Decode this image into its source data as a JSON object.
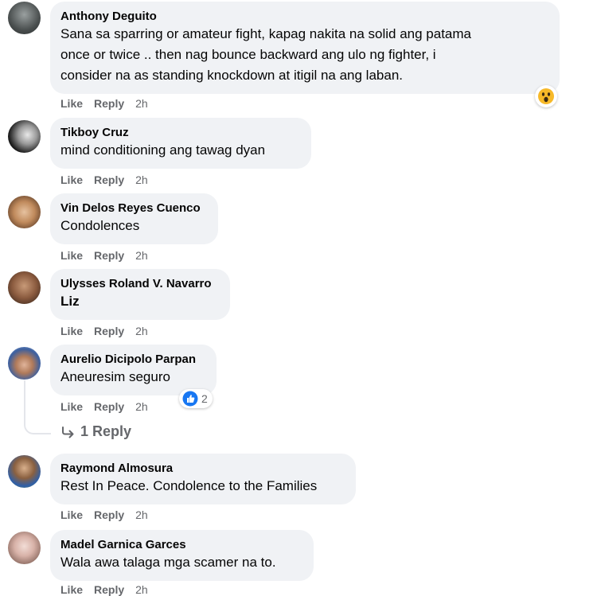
{
  "colors": {
    "bubble_bg": "#f0f2f5",
    "action_text": "#65676b",
    "like_blue": "#1877f2",
    "wow_yellow": "#f7b928"
  },
  "actions": {
    "like": "Like",
    "reply": "Reply"
  },
  "comments": [
    {
      "author": "Anthony Deguito",
      "lines": [
        "Sana sa sparring or amateur fight, kapag nakita na solid ang patama",
        "once or twice .. then nag bounce backward ang ulo ng fighter, i",
        "consider na as standing knockdown at itigil na ang laban."
      ],
      "time": "2h",
      "reaction_icon": "wow-reaction-icon"
    },
    {
      "author": "Tikboy Cruz",
      "lines": [
        "mind conditioning ang tawag dyan"
      ],
      "time": "2h"
    },
    {
      "author": "Vin Delos Reyes Cuenco",
      "lines": [
        "Condolences"
      ],
      "time": "2h"
    },
    {
      "author": "Ulysses Roland V. Navarro",
      "lines": [
        "Liz"
      ],
      "time": "2h"
    },
    {
      "author": "Aurelio Dicipolo Parpan",
      "lines": [
        "Aneuresim seguro"
      ],
      "time": "2h",
      "reaction_icon": "like-reaction-icon",
      "reaction_count": "2",
      "replies_link": "1 Reply"
    },
    {
      "author": "Raymond Almosura",
      "lines": [
        "Rest In Peace. Condolence to the Families"
      ],
      "time": "2h"
    },
    {
      "author": "Madel Garnica Garces",
      "lines": [
        "Wala awa talaga mga scamer na to."
      ],
      "time": "2h"
    }
  ]
}
